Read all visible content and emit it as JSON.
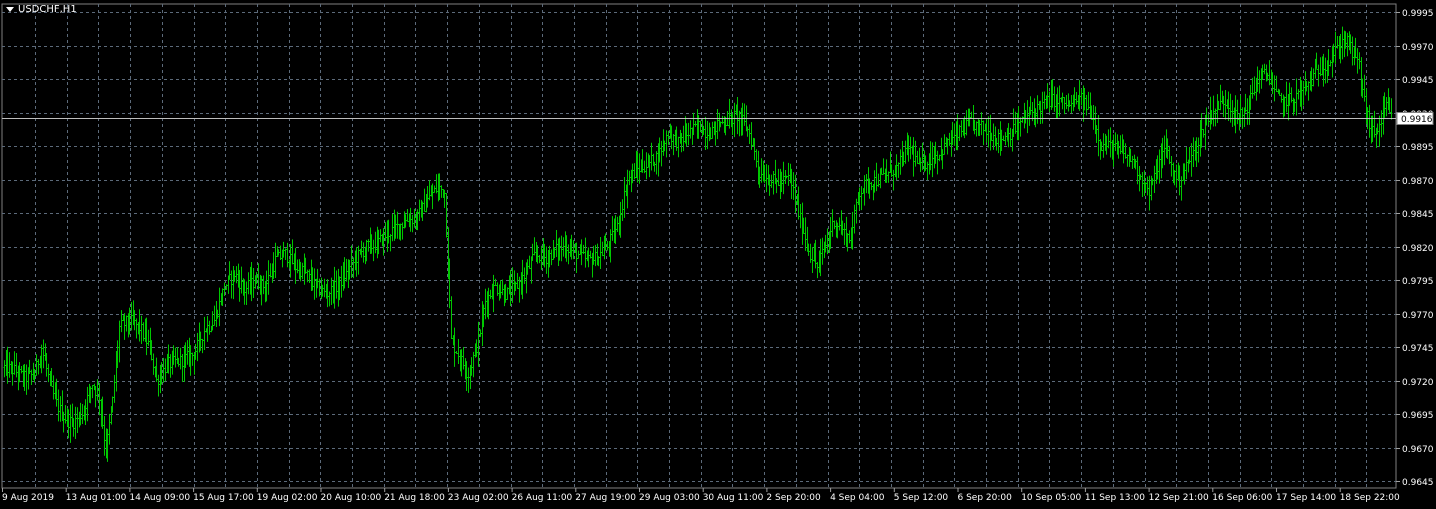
{
  "chart_data": {
    "type": "bar",
    "title": "USDCHF,H1",
    "symbol": "USDCHF",
    "timeframe": "H1",
    "current_price": "0.9916",
    "y_ticks": [
      "0.9995",
      "0.9970",
      "0.9945",
      "0.9920",
      "0.9895",
      "0.9870",
      "0.9845",
      "0.9820",
      "0.9795",
      "0.9770",
      "0.9745",
      "0.9720",
      "0.9695",
      "0.9670",
      "0.9645"
    ],
    "ylim": [
      0.9645,
      0.9995
    ],
    "x_labels": [
      "9 Aug 2019",
      "13 Aug 01:00",
      "14 Aug 09:00",
      "15 Aug 17:00",
      "19 Aug 02:00",
      "20 Aug 10:00",
      "21 Aug 18:00",
      "23 Aug 02:00",
      "26 Aug 11:00",
      "27 Aug 19:00",
      "29 Aug 03:00",
      "30 Aug 11:00",
      "2 Sep 20:00",
      "4 Sep 04:00",
      "5 Sep 12:00",
      "6 Sep 20:00",
      "10 Sep 05:00",
      "11 Sep 13:00",
      "12 Sep 21:00",
      "16 Sep 06:00",
      "17 Sep 14:00",
      "18 Sep 22:00"
    ],
    "price_path": [
      [
        0,
        0.973
      ],
      [
        6,
        0.9728
      ],
      [
        12,
        0.9722
      ],
      [
        18,
        0.9725
      ],
      [
        22,
        0.9745
      ],
      [
        28,
        0.9712
      ],
      [
        34,
        0.9695
      ],
      [
        40,
        0.9688
      ],
      [
        46,
        0.9696
      ],
      [
        52,
        0.9718
      ],
      [
        56,
        0.9708
      ],
      [
        60,
        0.9668
      ],
      [
        64,
        0.9705
      ],
      [
        68,
        0.976
      ],
      [
        74,
        0.9765
      ],
      [
        80,
        0.976
      ],
      [
        86,
        0.9745
      ],
      [
        90,
        0.972
      ],
      [
        96,
        0.9732
      ],
      [
        104,
        0.9735
      ],
      [
        112,
        0.974
      ],
      [
        118,
        0.9758
      ],
      [
        124,
        0.9765
      ],
      [
        130,
        0.979
      ],
      [
        136,
        0.98
      ],
      [
        142,
        0.9788
      ],
      [
        148,
        0.9795
      ],
      [
        154,
        0.979
      ],
      [
        160,
        0.981
      ],
      [
        166,
        0.9815
      ],
      [
        172,
        0.9805
      ],
      [
        178,
        0.98
      ],
      [
        184,
        0.979
      ],
      [
        190,
        0.9785
      ],
      [
        196,
        0.979
      ],
      [
        202,
        0.98
      ],
      [
        208,
        0.9812
      ],
      [
        214,
        0.982
      ],
      [
        220,
        0.9822
      ],
      [
        226,
        0.983
      ],
      [
        232,
        0.9835
      ],
      [
        238,
        0.984
      ],
      [
        244,
        0.9842
      ],
      [
        250,
        0.9855
      ],
      [
        256,
        0.9865
      ],
      [
        260,
        0.986
      ],
      [
        264,
        0.975
      ],
      [
        270,
        0.9735
      ],
      [
        274,
        0.9725
      ],
      [
        280,
        0.975
      ],
      [
        284,
        0.978
      ],
      [
        290,
        0.979
      ],
      [
        296,
        0.9785
      ],
      [
        302,
        0.979
      ],
      [
        308,
        0.98
      ],
      [
        314,
        0.9815
      ],
      [
        320,
        0.9812
      ],
      [
        326,
        0.9818
      ],
      [
        332,
        0.982
      ],
      [
        338,
        0.9815
      ],
      [
        344,
        0.981
      ],
      [
        350,
        0.9812
      ],
      [
        356,
        0.982
      ],
      [
        362,
        0.9835
      ],
      [
        368,
        0.987
      ],
      [
        374,
        0.9878
      ],
      [
        380,
        0.9882
      ],
      [
        386,
        0.9888
      ],
      [
        392,
        0.9905
      ],
      [
        398,
        0.9898
      ],
      [
        404,
        0.9905
      ],
      [
        410,
        0.991
      ],
      [
        416,
        0.9905
      ],
      [
        422,
        0.9912
      ],
      [
        428,
        0.9915
      ],
      [
        434,
        0.9918
      ],
      [
        440,
        0.9905
      ],
      [
        446,
        0.9875
      ],
      [
        452,
        0.987
      ],
      [
        458,
        0.9868
      ],
      [
        464,
        0.9872
      ],
      [
        470,
        0.984
      ],
      [
        476,
        0.9815
      ],
      [
        480,
        0.9805
      ],
      [
        486,
        0.9825
      ],
      [
        490,
        0.984
      ],
      [
        496,
        0.983
      ],
      [
        500,
        0.9825
      ],
      [
        504,
        0.986
      ],
      [
        510,
        0.9868
      ],
      [
        516,
        0.987
      ],
      [
        522,
        0.9875
      ],
      [
        528,
        0.988
      ],
      [
        534,
        0.9895
      ],
      [
        540,
        0.988
      ],
      [
        546,
        0.9885
      ],
      [
        552,
        0.989
      ],
      [
        558,
        0.9898
      ],
      [
        564,
        0.9905
      ],
      [
        570,
        0.9912
      ],
      [
        576,
        0.991
      ],
      [
        582,
        0.9905
      ],
      [
        588,
        0.99
      ],
      [
        594,
        0.9905
      ],
      [
        600,
        0.9912
      ],
      [
        606,
        0.992
      ],
      [
        612,
        0.9925
      ],
      [
        618,
        0.993
      ],
      [
        624,
        0.9928
      ],
      [
        630,
        0.9925
      ],
      [
        636,
        0.993
      ],
      [
        642,
        0.992
      ],
      [
        648,
        0.9895
      ],
      [
        654,
        0.9895
      ],
      [
        660,
        0.989
      ],
      [
        666,
        0.9885
      ],
      [
        672,
        0.987
      ],
      [
        676,
        0.986
      ],
      [
        680,
        0.9875
      ],
      [
        686,
        0.9895
      ],
      [
        690,
        0.9875
      ],
      [
        694,
        0.987
      ],
      [
        698,
        0.988
      ],
      [
        704,
        0.9895
      ],
      [
        710,
        0.9915
      ],
      [
        716,
        0.9925
      ],
      [
        722,
        0.993
      ],
      [
        728,
        0.9915
      ],
      [
        734,
        0.9925
      ],
      [
        740,
        0.9945
      ],
      [
        746,
        0.995
      ],
      [
        750,
        0.9935
      ],
      [
        754,
        0.9928
      ],
      [
        760,
        0.993
      ],
      [
        766,
        0.9935
      ],
      [
        772,
        0.9945
      ],
      [
        778,
        0.9955
      ],
      [
        784,
        0.996
      ],
      [
        788,
        0.997
      ],
      [
        792,
        0.9975
      ],
      [
        796,
        0.9965
      ],
      [
        800,
        0.9955
      ],
      [
        804,
        0.992
      ],
      [
        808,
        0.9905
      ],
      [
        812,
        0.991
      ],
      [
        816,
        0.9925
      ],
      [
        819,
        0.9916
      ]
    ],
    "grid": true,
    "colors": {
      "background": "#000000",
      "bars": "#00c800",
      "grid": "#5c6a7a",
      "text": "#ffffff",
      "bid_line": "#bdbdbd"
    }
  }
}
